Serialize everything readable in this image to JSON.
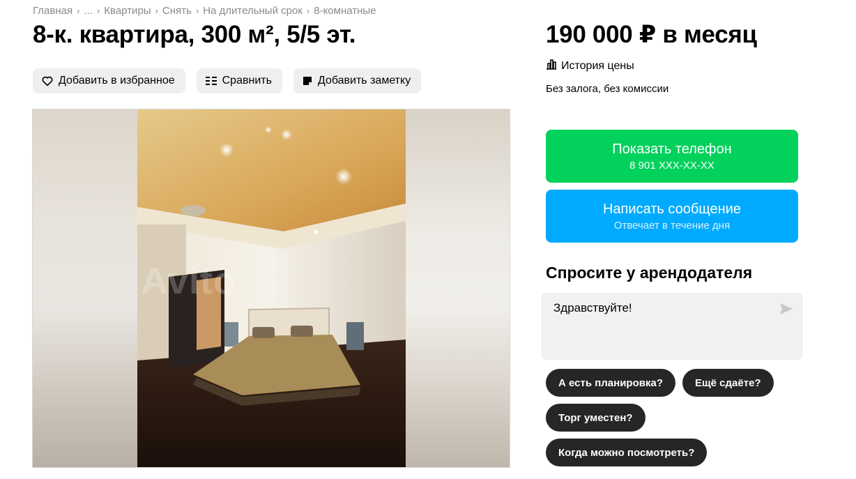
{
  "breadcrumb": {
    "items": [
      "Главная",
      "...",
      "Квартиры",
      "Снять",
      "На длительный срок",
      "8-комнатные"
    ]
  },
  "listing": {
    "title": "8-к. квартира, 300 м², 5/5 эт.",
    "price": "190 000 ₽ в месяц",
    "price_history": "История цены",
    "terms": "Без залога, без комиссии"
  },
  "actions": {
    "favorite": "Добавить в избранное",
    "compare": "Сравнить",
    "note": "Добавить заметку"
  },
  "gallery": {
    "watermark": "Avito"
  },
  "contact": {
    "phone_label": "Показать телефон",
    "phone_number": "8 901 XXX-XX-XX",
    "message_label": "Написать сообщение",
    "message_sub": "Отвечает в течение дня"
  },
  "ask": {
    "title": "Спросите у арендодателя",
    "message": "Здравствуйте!",
    "chips": [
      "А есть планировка?",
      "Ещё сдаёте?",
      "Торг уместен?",
      "Когда можно посмотреть?"
    ]
  },
  "colors": {
    "phone_button": "#02d15c",
    "message_button": "#00aaff",
    "chip": "#262626",
    "action_button": "#efefef"
  }
}
